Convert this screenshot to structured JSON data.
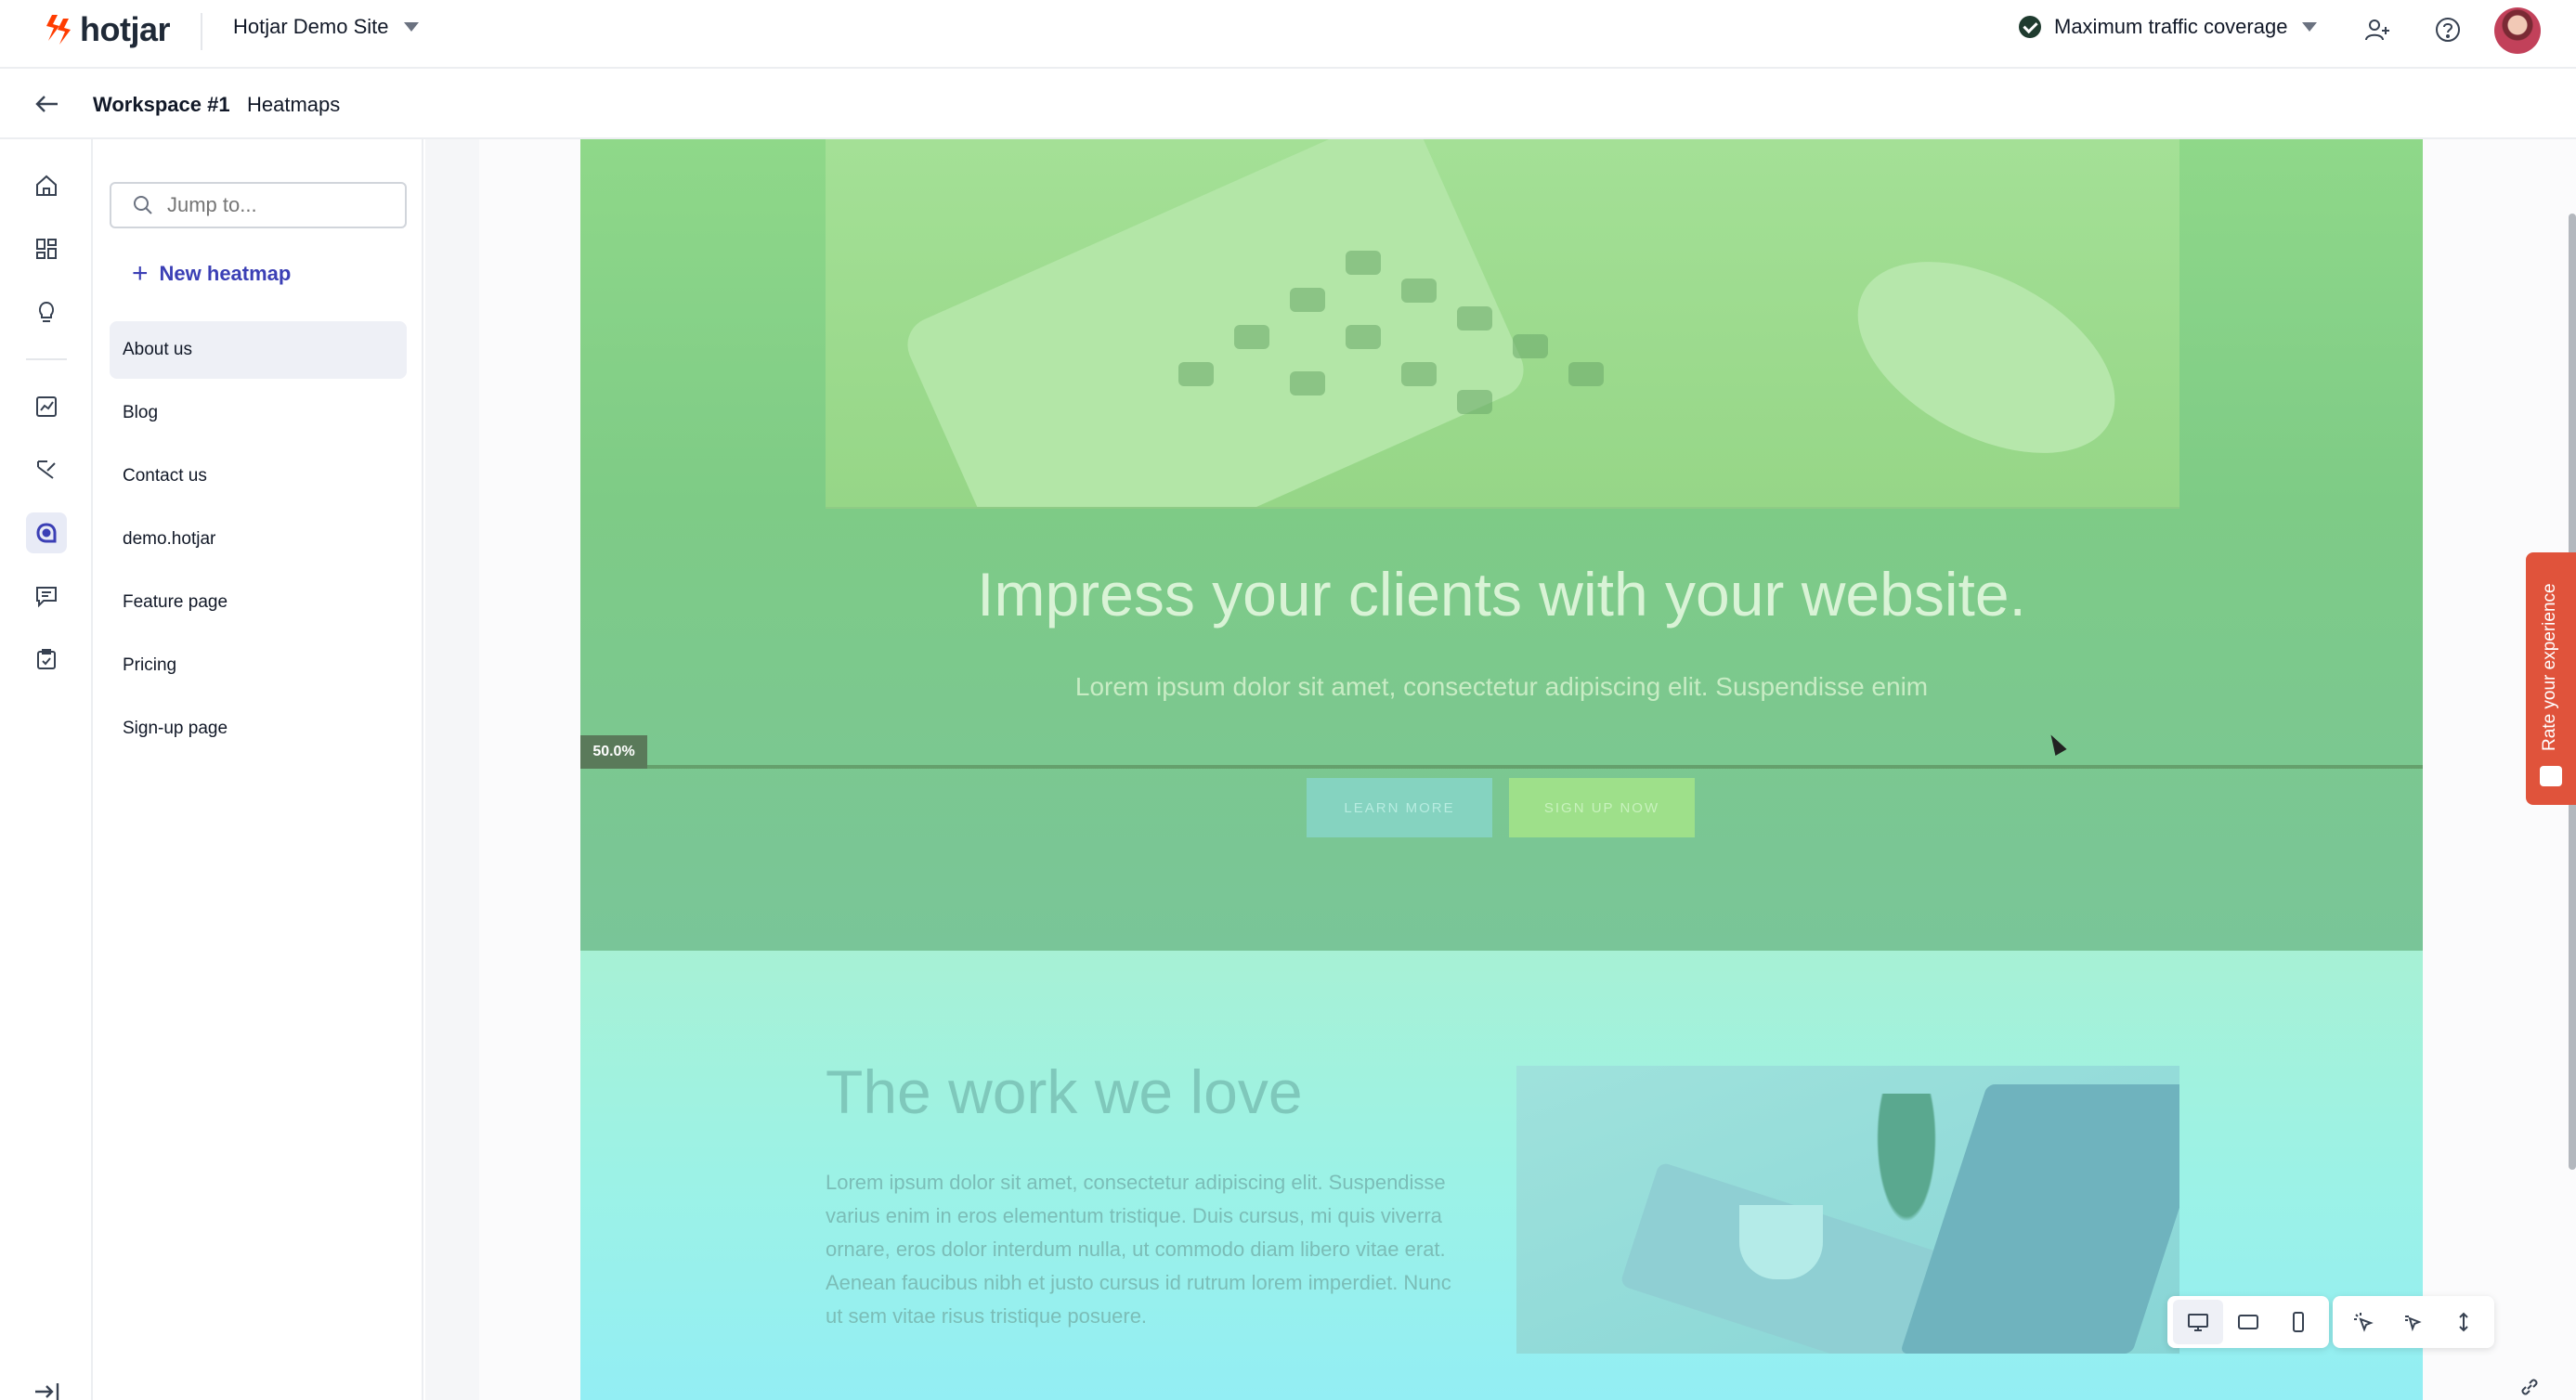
{
  "app": {
    "name": "hotjar",
    "site": "Hotjar Demo Site"
  },
  "topbar": {
    "traffic_label": "Maximum traffic coverage"
  },
  "breadcrumb": {
    "workspace": "Workspace #1",
    "section": "Heatmaps"
  },
  "panel": {
    "search_placeholder": "Jump to...",
    "new_heatmap_label": "New heatmap",
    "items": [
      "About us",
      "Blog",
      "Contact us",
      "demo.hotjar",
      "Feature page",
      "Pricing",
      "Sign-up page"
    ],
    "active_index": 0
  },
  "rail_icons": [
    "home-icon",
    "dashboard-icon",
    "lightbulb-icon",
    "trends-icon",
    "funnels-icon",
    "heatmaps-icon",
    "feedback-icon",
    "surveys-icon"
  ],
  "heatmap_preview": {
    "hero_title": "Impress your clients with your website.",
    "hero_subtitle": "Lorem ipsum dolor sit amet, consectetur adipiscing elit. Suspendisse enim",
    "scroll_percent": "50.0%",
    "learn_more": "LEARN MORE",
    "sign_up": "SIGN UP NOW",
    "work_title": "The work we love",
    "work_body": "Lorem ipsum dolor sit amet, consectetur adipiscing elit. Suspendisse varius enim in eros elementum tristique. Duis cursus, mi quis viverra ornare, eros dolor interdum nulla, ut commodo diam libero vitae erat. Aenean faucibus nibh et justo cursus id rutrum lorem imperdiet. Nunc ut sem vitae risus tristique posuere."
  },
  "feedback_tab": {
    "label": "Rate your experience"
  },
  "toolbar": {
    "device_icons": [
      "desktop-icon",
      "tablet-icon",
      "mobile-icon"
    ],
    "map_icons": [
      "click-map-icon",
      "move-map-icon",
      "scroll-map-icon"
    ]
  },
  "colors": {
    "accent": "#3b3fb5",
    "feedback_tab": "#e0533b",
    "logo": "#ff3c00"
  }
}
